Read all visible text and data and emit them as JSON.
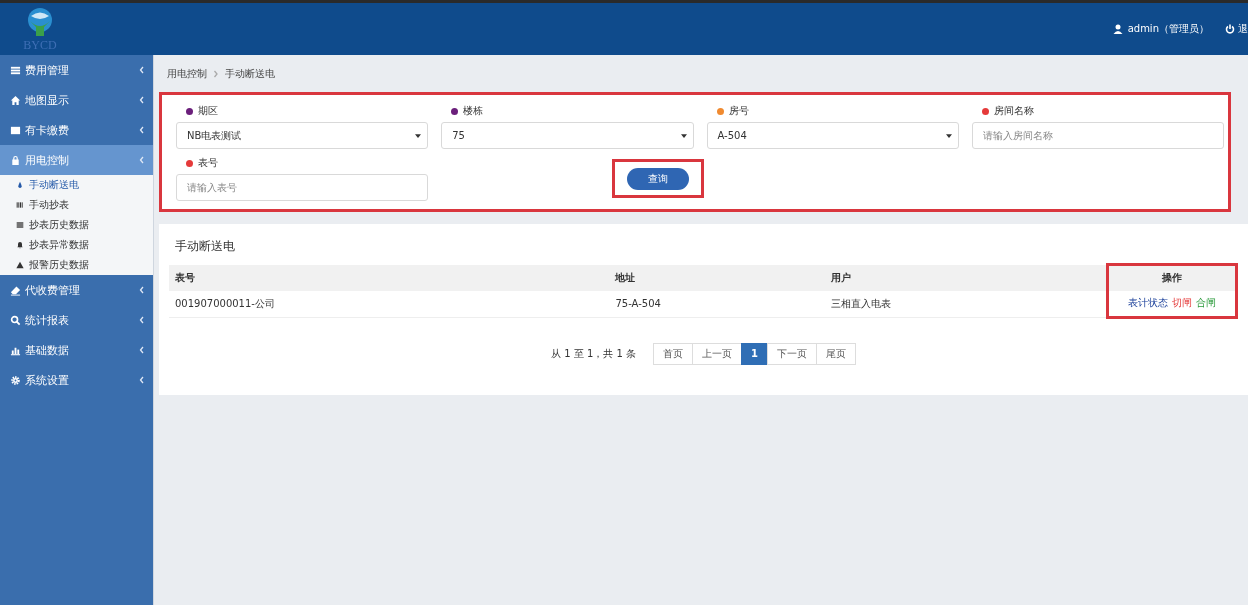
{
  "header": {
    "logo_text": "BYCD",
    "user": "admin（管理员）",
    "logout": "退"
  },
  "sidebar": {
    "items": [
      {
        "label": "费用管理",
        "selected": false
      },
      {
        "label": "地图显示",
        "selected": false
      },
      {
        "label": "有卡缴费",
        "selected": false
      },
      {
        "label": "用电控制",
        "selected": true,
        "children": [
          {
            "label": "手动断送电",
            "selected": true
          },
          {
            "label": "手动抄表",
            "selected": false
          },
          {
            "label": "抄表历史数据",
            "selected": false
          },
          {
            "label": "抄表异常数据",
            "selected": false
          },
          {
            "label": "报警历史数据",
            "selected": false
          }
        ]
      },
      {
        "label": "代收费管理",
        "selected": false
      },
      {
        "label": "统计报表",
        "selected": false
      },
      {
        "label": "基础数据",
        "selected": false
      },
      {
        "label": "系统设置",
        "selected": false
      }
    ]
  },
  "breadcrumb": [
    "用电控制",
    "手动断送电"
  ],
  "filters": [
    {
      "label": "期区",
      "color": "#6b1f7b",
      "kind": "select",
      "value": "NB电表测试"
    },
    {
      "label": "楼栋",
      "color": "#6b1f7b",
      "kind": "select",
      "value": "75"
    },
    {
      "label": "房号",
      "color": "#f08a30",
      "kind": "select",
      "value": "A-504"
    },
    {
      "label": "房间名称",
      "color": "#e53a3a",
      "kind": "input",
      "placeholder": "请输入房间名称"
    },
    {
      "label": "表号",
      "color": "#e53a3a",
      "kind": "input",
      "placeholder": "请输入表号"
    }
  ],
  "query_button": "查询",
  "table": {
    "title": "手动断送电",
    "columns": [
      "表号",
      "地址",
      "用户",
      "操作"
    ],
    "rows": [
      {
        "cells": [
          "001907000011-公司",
          "75-A-504",
          "三相直入电表"
        ],
        "actions": [
          {
            "label": "表计状态"
          },
          {
            "label": "切闸"
          },
          {
            "label": "合闸"
          }
        ]
      }
    ]
  },
  "pagination": {
    "summary": "从 1 至 1，共 1 条",
    "pages": [
      {
        "label": "首页",
        "selected": false
      },
      {
        "label": "上一页",
        "selected": false
      },
      {
        "label": "1",
        "selected": true
      },
      {
        "label": "下一页",
        "selected": false
      },
      {
        "label": "尾页",
        "selected": false
      }
    ]
  }
}
